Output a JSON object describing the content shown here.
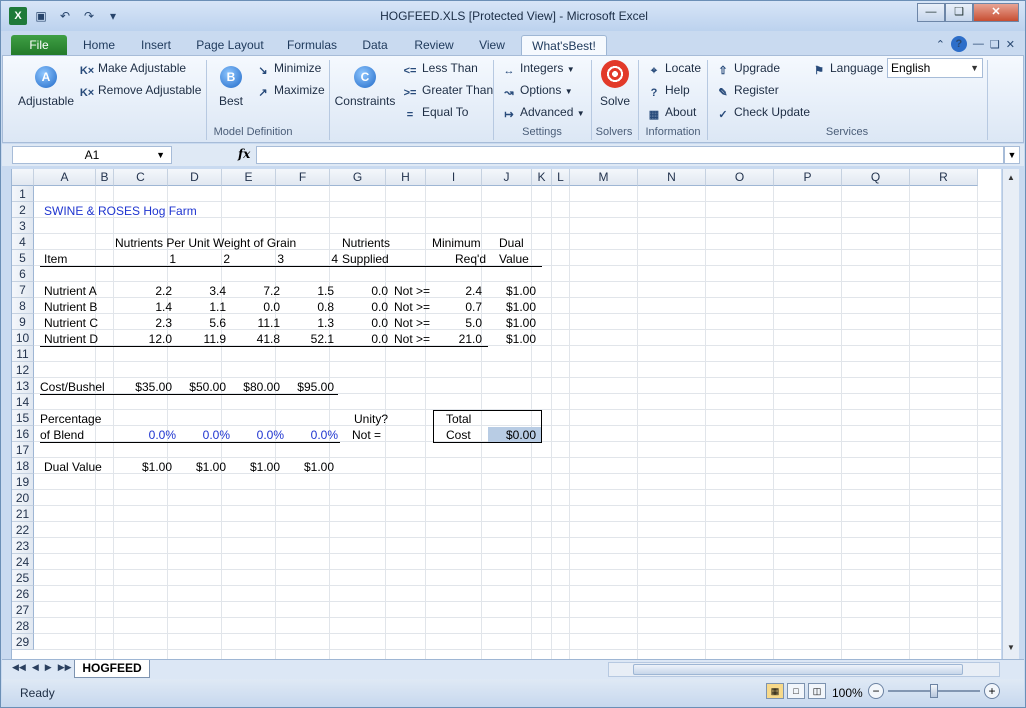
{
  "window": {
    "title": "HOGFEED.XLS  [Protected View]  -  Microsoft Excel",
    "app_letter": "X"
  },
  "tabs": [
    {
      "label": "File"
    },
    {
      "label": "Home"
    },
    {
      "label": "Insert"
    },
    {
      "label": "Page Layout"
    },
    {
      "label": "Formulas"
    },
    {
      "label": "Data"
    },
    {
      "label": "Review"
    },
    {
      "label": "View"
    },
    {
      "label": "What'sBest!"
    }
  ],
  "ribbon": {
    "adjustable": "Adjustable",
    "make_adjustable": "Make Adjustable",
    "remove_adjustable": "Remove Adjustable",
    "best": "Best",
    "minimize": "Minimize",
    "maximize": "Maximize",
    "constraints": "Constraints",
    "less_than": "Less Than",
    "greater_than": "Greater Than",
    "equal_to": "Equal To",
    "integers": "Integers",
    "options": "Options",
    "advanced": "Advanced",
    "solve": "Solve",
    "locate": "Locate",
    "help": "Help",
    "about": "About",
    "upgrade": "Upgrade",
    "register": "Register",
    "check_update": "Check Update",
    "language_label": "Language",
    "language_value": "English",
    "groups": {
      "model_definition": "Model Definition",
      "settings": "Settings",
      "solvers": "Solvers",
      "information": "Information",
      "services": "Services"
    },
    "icon_letters": {
      "a": "A",
      "b": "B",
      "c": "C"
    },
    "op_symbols": {
      "lt": "<=",
      "gt": ">=",
      "eq": "="
    }
  },
  "formula_bar": {
    "name_box": "A1",
    "fx": "fx",
    "formula": ""
  },
  "columns": [
    "A",
    "B",
    "C",
    "D",
    "E",
    "F",
    "G",
    "H",
    "I",
    "J",
    "K",
    "L",
    "M",
    "N",
    "O",
    "P",
    "Q",
    "R"
  ],
  "rows": [
    "1",
    "2",
    "3",
    "4",
    "5",
    "6",
    "7",
    "8",
    "9",
    "10",
    "11",
    "12",
    "13",
    "14",
    "15",
    "16",
    "17",
    "18",
    "19",
    "20",
    "21",
    "22",
    "23",
    "24",
    "25",
    "26",
    "27",
    "28",
    "29"
  ],
  "sheet": {
    "title": "SWINE & ROSES Hog Farm",
    "header_nutrients_per_unit": "Nutrients Per Unit Weight of Grain",
    "header_nutrients": "Nutrients",
    "header_minimum": "Minimum",
    "header_dual": "Dual",
    "header_item": "Item",
    "grain_numbers": [
      "1",
      "2",
      "3",
      "4"
    ],
    "header_supplied": "Supplied",
    "header_reqd": "Req'd",
    "header_value": "Value",
    "nutrients": [
      {
        "name": "Nutrient A",
        "values": [
          "2.2",
          "3.4",
          "7.2",
          "1.5"
        ],
        "supplied": "0.0",
        "op": "Not >=",
        "min": "2.4",
        "dual": "$1.00"
      },
      {
        "name": "Nutrient B",
        "values": [
          "1.4",
          "1.1",
          "0.0",
          "0.8"
        ],
        "supplied": "0.0",
        "op": "Not >=",
        "min": "0.7",
        "dual": "$1.00"
      },
      {
        "name": "Nutrient C",
        "values": [
          "2.3",
          "5.6",
          "11.1",
          "1.3"
        ],
        "supplied": "0.0",
        "op": "Not >=",
        "min": "5.0",
        "dual": "$1.00"
      },
      {
        "name": "Nutrient D",
        "values": [
          "12.0",
          "11.9",
          "41.8",
          "52.1"
        ],
        "supplied": "0.0",
        "op": "Not >=",
        "min": "21.0",
        "dual": "$1.00"
      }
    ],
    "cost_label": "Cost/Bushel",
    "costs": [
      "$35.00",
      "$50.00",
      "$80.00",
      "$95.00"
    ],
    "percentage_label": "Percentage",
    "of_blend_label": "of Blend",
    "blend": [
      "0.0%",
      "0.0%",
      "0.0%",
      "0.0%"
    ],
    "unity_label": "Unity?",
    "not_eq_label": "Not =",
    "total_label": "Total",
    "cost_total_label": "Cost",
    "total_cost": "$0.00",
    "dual_value_label": "Dual Value",
    "dual_values": [
      "$1.00",
      "$1.00",
      "$1.00",
      "$1.00"
    ]
  },
  "sheet_tab": "HOGFEED",
  "status": {
    "ready": "Ready",
    "zoom": "100%"
  }
}
